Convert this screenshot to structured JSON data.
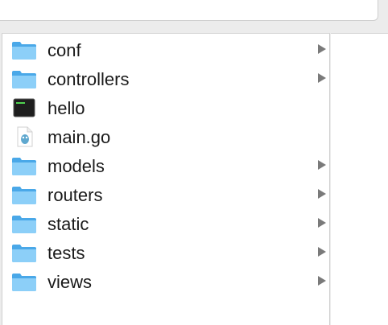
{
  "files": [
    {
      "label": "conf",
      "icon": "folder-icon",
      "kind": "folder"
    },
    {
      "label": "controllers",
      "icon": "folder-icon",
      "kind": "folder"
    },
    {
      "label": "hello",
      "icon": "terminal-executable-icon",
      "kind": "exec"
    },
    {
      "label": "main.go",
      "icon": "go-file-icon",
      "kind": "go"
    },
    {
      "label": "models",
      "icon": "folder-icon",
      "kind": "folder"
    },
    {
      "label": "routers",
      "icon": "folder-icon",
      "kind": "folder"
    },
    {
      "label": "static",
      "icon": "folder-icon",
      "kind": "folder"
    },
    {
      "label": "tests",
      "icon": "folder-icon",
      "kind": "folder"
    },
    {
      "label": "views",
      "icon": "folder-icon",
      "kind": "folder"
    }
  ],
  "colors": {
    "folder": "#5fb8f0",
    "folder_light": "#8fd0f8",
    "chevron": "#7a7a7a",
    "terminal": "#1e1e1e"
  }
}
